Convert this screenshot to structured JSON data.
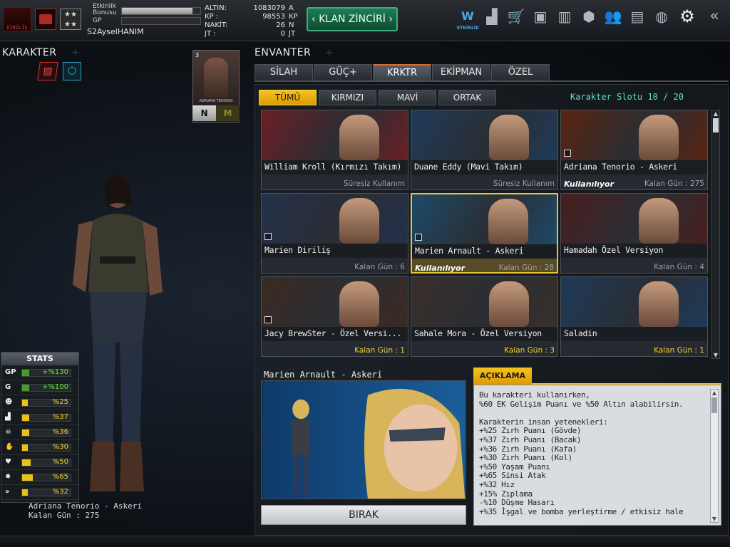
{
  "topbar": {
    "logo_text": "DİRİLİŞ",
    "event_bonus_label": "Etkinlik Bonusu",
    "event_bonus_fill": 0.9,
    "gp_label": "GP",
    "gp_fill": 0.0,
    "username": "S2AyselHANIM",
    "currencies": [
      {
        "label": "ALTIN:",
        "value": "1083079",
        "unit": "A"
      },
      {
        "label": "KP :",
        "value": "98553",
        "unit": "KP"
      },
      {
        "label": "NAKİT:",
        "value": "26",
        "unit": "N"
      },
      {
        "label": "JT :",
        "value": "0",
        "unit": "JT"
      }
    ],
    "klan_button": "KLAN ZİNCİRİ",
    "event_icon_label": "ETKİNLİK"
  },
  "left": {
    "title": "KARAKTER",
    "char_level": "3",
    "card_name": "ADRIANA TENORIO",
    "btn_n": "N",
    "btn_m": "M",
    "character_name": "Adriana Tenorio - Askeri",
    "character_days": "Kalan Gün : 275"
  },
  "stats": {
    "title": "STATS",
    "rows": [
      {
        "key": "GP",
        "value": "+%130",
        "fill": 0.15,
        "green": true
      },
      {
        "key": "G",
        "value": "+%100",
        "fill": 0.15,
        "green": true
      },
      {
        "key": "head",
        "value": "%25",
        "fill": 0.12,
        "green": false
      },
      {
        "key": "leg",
        "value": "%37",
        "fill": 0.15,
        "green": false
      },
      {
        "key": "skull",
        "value": "%36",
        "fill": 0.15,
        "green": false
      },
      {
        "key": "arm",
        "value": "%30",
        "fill": 0.12,
        "green": false
      },
      {
        "key": "heart",
        "value": "%50",
        "fill": 0.18,
        "green": false
      },
      {
        "key": "burst",
        "value": "%65",
        "fill": 0.22,
        "green": false
      },
      {
        "key": "speed",
        "value": "%32",
        "fill": 0.12,
        "green": false
      }
    ]
  },
  "inventory": {
    "title": "ENVANTER",
    "tabs": [
      "SİLAH",
      "GÜÇ+",
      "KRKTR",
      "EKİPMAN",
      "ÖZEL"
    ],
    "active_tab": 2,
    "subtabs": [
      "TÜMÜ",
      "KIRMIZI",
      "MAVİ",
      "ORTAK"
    ],
    "active_subtab": 0,
    "slot_text": "Karakter Slotu 10 / 20",
    "cards": [
      {
        "name": "William Kroll (Kırmızı Takım)",
        "status": "",
        "days": "Süresiz Kullanım",
        "yellow": false,
        "check": false,
        "color": "#6a1f24",
        "selected": false
      },
      {
        "name": "Duane Eddy (Mavi Takım)",
        "status": "",
        "days": "Süresiz Kullanım",
        "yellow": false,
        "check": false,
        "color": "#1f3a5a",
        "selected": false
      },
      {
        "name": "Adriana Tenorio - Askeri",
        "status": "Kullanılıyor",
        "days": "Kalan Gün : 275",
        "yellow": false,
        "check": true,
        "color": "#5a2410",
        "selected": false
      },
      {
        "name": "Marien Diriliş",
        "status": "",
        "days": "Kalan Gün : 6",
        "yellow": false,
        "check": true,
        "color": "#24304c",
        "selected": false
      },
      {
        "name": "Marien Arnault - Askeri",
        "status": "Kullanılıyor",
        "days": "Kalan Gün : 28",
        "yellow": false,
        "check": true,
        "color": "#1d4a68",
        "selected": true
      },
      {
        "name": "Hamadah Özel Versiyon",
        "status": "",
        "days": "Kalan Gün : 4",
        "yellow": false,
        "check": false,
        "color": "#4a1e1e",
        "selected": false
      },
      {
        "name": "Jacy BrewSter - Özel Versi...",
        "status": "",
        "days": "Kalan Gün : 1",
        "yellow": true,
        "check": true,
        "color": "#3c2a22",
        "selected": false
      },
      {
        "name": "Sahale Mora - Özel Versiyon",
        "status": "",
        "days": "Kalan Gün : 3",
        "yellow": true,
        "check": false,
        "color": "#3a2f2a",
        "selected": false
      },
      {
        "name": "Saladin",
        "status": "",
        "days": "Kalan Gün : 1",
        "yellow": true,
        "check": false,
        "color": "#1e3a5a",
        "selected": false
      }
    ]
  },
  "preview": {
    "name": "Marien Arnault - Askeri",
    "release_button": "BIRAK"
  },
  "description": {
    "tab": "AÇIKLAMA",
    "text": "Bu karakteri kullanırken,\n%60 EK Gelişim Puanı ve %50 Altın alabilirsin.\n\nKarakterin insan yetenekleri:\n+%25 Zırh Puanı (Gövde)\n+%37 Zırh Puanı (Bacak)\n+%36 Zırh Puanı (Kafa)\n+%30 Zırh Puanı (Kol)\n+%50 Yaşam Puanı\n+%65 Sinsi Atak\n+%32 Hız\n+15% Zıplama\n-%10 Düşme Hasarı\n+%35 İşgal ve bomba yerleştirme / etkisiz hale"
  },
  "colors": {
    "accent": "#f6c21e",
    "klan": "#1d7e54",
    "tab_active_border": "#d86a2b"
  }
}
